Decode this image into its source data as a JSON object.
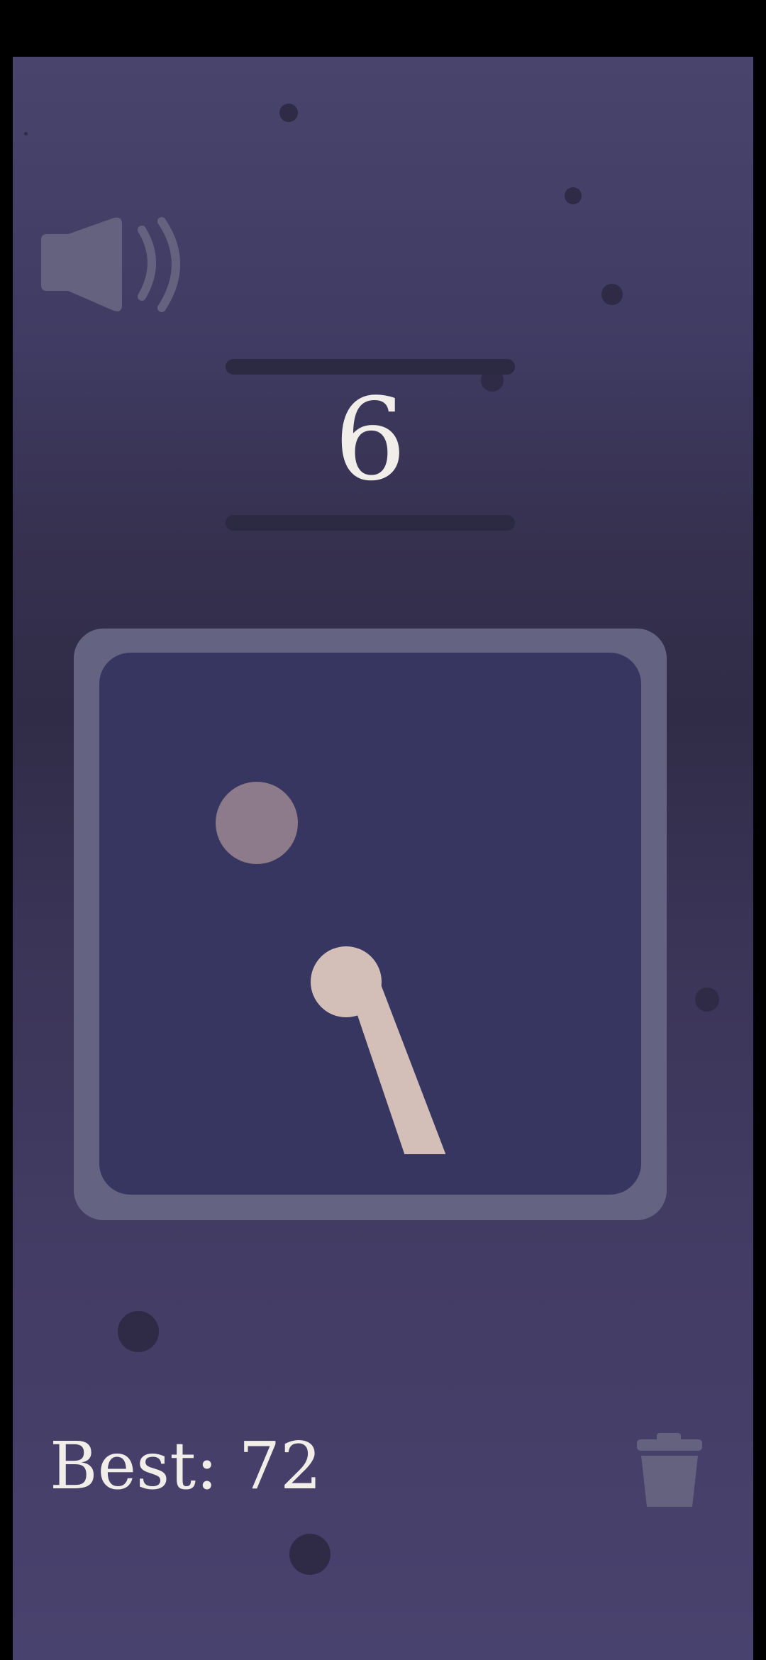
{
  "game": {
    "score": "6",
    "best_label": "Best: 72",
    "sound_icon": "speaker-on-icon",
    "reset_icon": "trash-icon"
  },
  "colors": {
    "background_top": "#48446c",
    "background_mid": "#302c47",
    "background_bottom": "#48426e",
    "board_frame": "#646381",
    "board": "#363660",
    "target_ball": "#8d7a8a",
    "player_ball": "#d4beb8",
    "text": "#f1eeea",
    "icon": "#64627e"
  }
}
